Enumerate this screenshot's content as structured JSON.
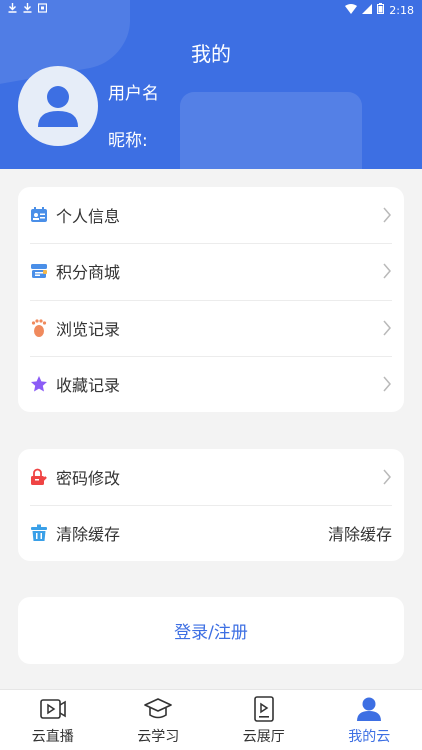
{
  "status_bar": {
    "time": "2:18"
  },
  "header": {
    "title": "我的",
    "username": "用户名",
    "nickname_label": "昵称:"
  },
  "menu1": [
    {
      "label": "个人信息",
      "icon": "id-card-icon",
      "color": "#4a8fe8"
    },
    {
      "label": "积分商城",
      "icon": "store-icon",
      "color": "#4a8fe8"
    },
    {
      "label": "浏览记录",
      "icon": "footprint-icon",
      "color": "#f08a5d"
    },
    {
      "label": "收藏记录",
      "icon": "star-icon",
      "color": "#8b5cf6"
    }
  ],
  "menu2": [
    {
      "label": "密码修改",
      "icon": "lock-edit-icon",
      "color": "#ef4444"
    },
    {
      "label": "清除缓存",
      "icon": "trash-icon",
      "color": "#3aa0e8",
      "value": "清除缓存"
    }
  ],
  "login_button": "登录/注册",
  "nav": [
    {
      "label": "云直播",
      "icon": "live-video-icon"
    },
    {
      "label": "云学习",
      "icon": "graduation-cap-icon"
    },
    {
      "label": "云展厅",
      "icon": "exhibition-icon"
    },
    {
      "label": "我的云",
      "icon": "user-icon",
      "active": true
    }
  ],
  "colors": {
    "primary": "#3d6fe3",
    "background": "#f3f3f3"
  }
}
